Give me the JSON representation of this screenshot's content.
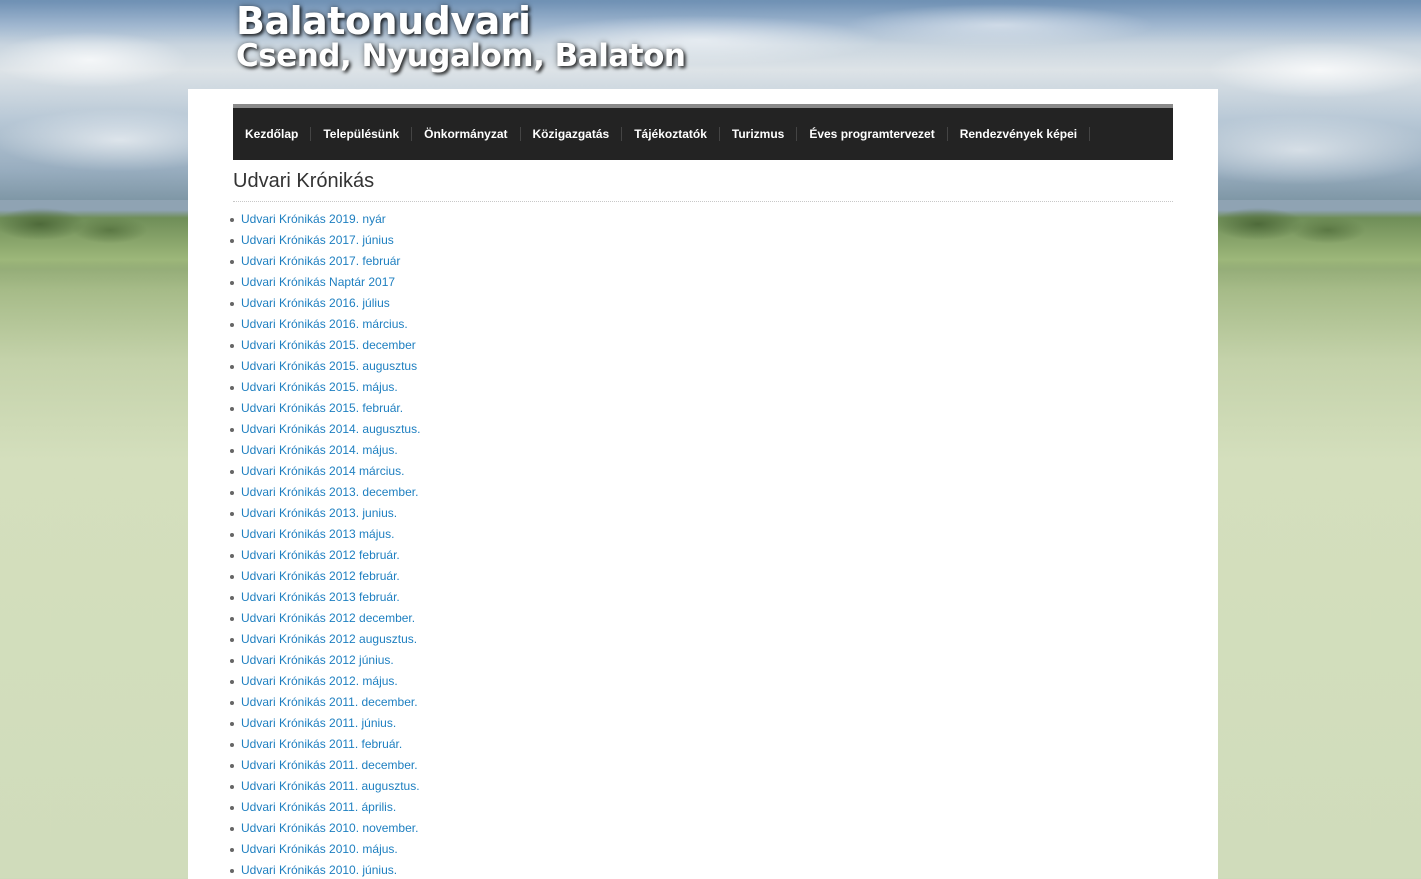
{
  "header": {
    "title": "Balatonudvari",
    "subtitle": "Csend, Nyugalom, Balaton"
  },
  "nav": {
    "items": [
      "Kezdőlap",
      "Településünk",
      "Önkormányzat",
      "Közigazgatás",
      "Tájékoztatók",
      "Turizmus",
      "Éves programtervezet",
      "Rendezvények képei"
    ]
  },
  "main": {
    "title": "Udvari Krónikás",
    "items": [
      "Udvari Krónikás 2019. nyár",
      "Udvari Krónikás 2017. június",
      "Udvari Krónikás 2017. február",
      "Udvari Krónikás Naptár 2017",
      "Udvari Krónikás 2016. július",
      "Udvari Krónikás 2016. március.",
      "Udvari Krónikás 2015. december",
      "Udvari Krónikás 2015. augusztus",
      "Udvari Krónikás 2015. május.",
      "Udvari Krónikás 2015. február.",
      "Udvari Krónikás 2014. augusztus.",
      "Udvari Krónikás 2014. május.",
      "Udvari Krónikás 2014 március.",
      "Udvari Krónikás 2013. december.",
      "Udvari Krónikás 2013. junius.",
      "Udvari Krónikás 2013 május.",
      "Udvari Krónikás 2012 február.",
      "Udvari Krónikás 2012 február.",
      "Udvari Krónikás 2013 február.",
      "Udvari Krónikás 2012 december.",
      "Udvari Krónikás 2012 augusztus.",
      "Udvari Krónikás 2012 június.",
      "Udvari Krónikás 2012. május.",
      "Udvari Krónikás 2011. december.",
      "Udvari Krónikás 2011. június.",
      "Udvari Krónikás 2011. február.",
      "Udvari Krónikás 2011. december.",
      "Udvari Krónikás 2011. augusztus.",
      "Udvari Krónikás 2011. április.",
      "Udvari Krónikás 2010. november.",
      "Udvari Krónikás 2010. május.",
      "Udvari Krónikás 2010. június."
    ]
  },
  "colors": {
    "link": "#1e7fc0",
    "nav_bg": "#232323",
    "nav_border": "#8a8a8a"
  }
}
